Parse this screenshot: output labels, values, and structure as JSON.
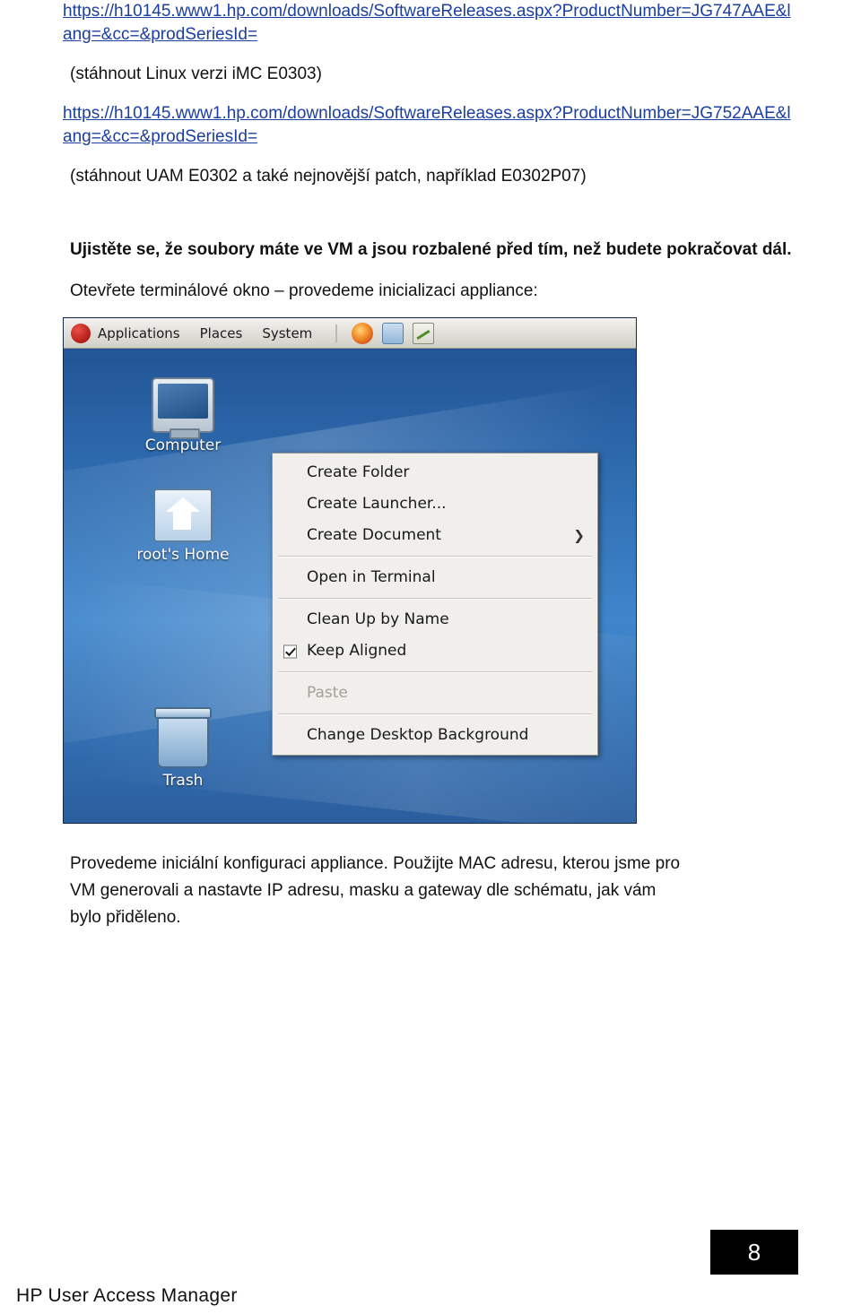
{
  "document": {
    "url1": "https://h10145.www1.hp.com/downloads/SoftwareReleases.aspx?ProductNumber=JG747AAE&lang=&cc=&prodSeriesId=",
    "note1": "(stáhnout Linux verzi iMC E0303)",
    "url2": "https://h10145.www1.hp.com/downloads/SoftwareReleases.aspx?ProductNumber=JG752AAE&lang=&cc=&prodSeriesId=",
    "note2": "(stáhnout UAM E0302 a také nejnovější patch, například E0302P07)",
    "bold_note": "Ujistěte se, že soubory máte ve VM a jsou rozbalené před tím, než budete pokračovat dál.",
    "instruction": "Otevřete terminálové okno – provedeme inicializaci appliance:",
    "closing_paragraph": "Provedeme iniciální konfiguraci appliance. Použijte MAC adresu, kterou jsme pro VM generovali a nastavte IP adresu, masku a gateway dle schématu, jak vám bylo přiděleno.",
    "footer_title": "HP User Access Manager",
    "page_number": "8"
  },
  "screenshot": {
    "panel": {
      "applications": "Applications",
      "places": "Places",
      "system": "System"
    },
    "desktop_icons": [
      {
        "label": "Computer",
        "icon": "computer-icon"
      },
      {
        "label": "root's Home",
        "icon": "home-folder-icon"
      },
      {
        "label": "Trash",
        "icon": "trash-icon"
      }
    ],
    "context_menu": {
      "items": [
        {
          "label": "Create Folder",
          "enabled": true,
          "submenu": false,
          "checked": false
        },
        {
          "label": "Create Launcher...",
          "enabled": true,
          "submenu": false,
          "checked": false
        },
        {
          "label": "Create Document",
          "enabled": true,
          "submenu": true,
          "checked": false
        },
        {
          "label": "Open in Terminal",
          "enabled": true,
          "submenu": false,
          "checked": false
        },
        {
          "label": "Clean Up by Name",
          "enabled": true,
          "submenu": false,
          "checked": false
        },
        {
          "label": "Keep Aligned",
          "enabled": true,
          "submenu": false,
          "checked": true
        },
        {
          "label": "Paste",
          "enabled": false,
          "submenu": false,
          "checked": false
        },
        {
          "label": "Change Desktop Background",
          "enabled": true,
          "submenu": false,
          "checked": false
        }
      ]
    }
  }
}
